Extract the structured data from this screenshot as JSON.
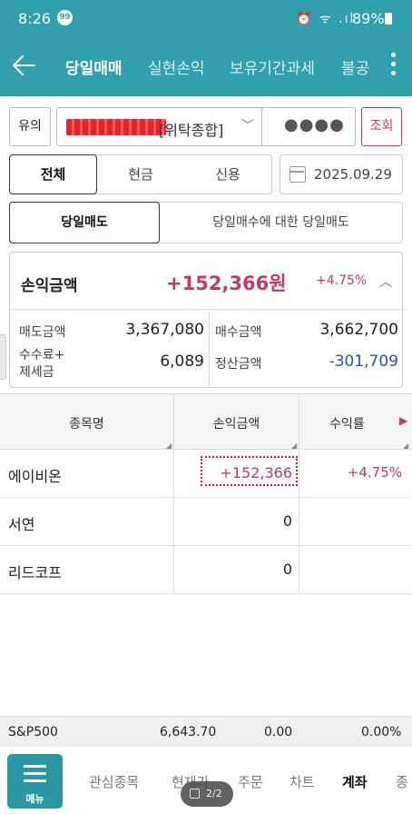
{
  "status_bar": {
    "time": "8:26",
    "badge": "99",
    "icons": "⏰ ᯤ .ıl",
    "battery": "89%"
  },
  "app_bar": {
    "tabs": [
      {
        "label": "당일매매",
        "active": true
      },
      {
        "label": "실현손익",
        "active": false
      },
      {
        "label": "보유기간과세",
        "active": false
      },
      {
        "label": "불공",
        "active": false
      }
    ]
  },
  "account": {
    "notice_label": "유의",
    "type": "[위탁종합]",
    "password_mask": "●●●●",
    "query_label": "조회"
  },
  "filter": {
    "tabs": [
      {
        "label": "전체",
        "active": true
      },
      {
        "label": "현금",
        "active": false
      },
      {
        "label": "신용",
        "active": false
      }
    ],
    "date": "2025.09.29"
  },
  "sell_type": {
    "tabs": [
      {
        "label": "당일매도",
        "active": true
      },
      {
        "label": "당일매수에 대한 당일매도",
        "active": false
      }
    ]
  },
  "summary": {
    "pl_label": "손익금액",
    "pl_value": "+152,366원",
    "pl_pct": "+4.75%",
    "sell_label": "매도금액",
    "sell_value": "3,367,080",
    "buy_label": "매수금액",
    "buy_value": "3,662,700",
    "fee_label_1": "수수료+",
    "fee_label_2": "제세금",
    "fee_value": "6,089",
    "settle_label": "정산금액",
    "settle_value": "-301,709"
  },
  "table": {
    "headers": [
      "종목명",
      "손익금액",
      "수익률"
    ],
    "rows": [
      {
        "name": "에이비온",
        "amount": "+152,366",
        "pct": "+4.75%"
      },
      {
        "name": "서연",
        "amount": "0",
        "pct": ""
      },
      {
        "name": "리드코프",
        "amount": "0",
        "pct": ""
      }
    ]
  },
  "ticker": {
    "name": "S&P500",
    "value": "6,643.70",
    "change": "0.00",
    "pct": "0.00%"
  },
  "bottom_nav": {
    "menu_label": "메뉴",
    "items": [
      {
        "label": "관심종목",
        "active": false
      },
      {
        "label": "현재가",
        "active": false
      },
      {
        "label": "주문",
        "active": false
      },
      {
        "label": "차트",
        "active": false
      },
      {
        "label": "계좌",
        "active": true
      },
      {
        "label": "종",
        "active": false
      }
    ],
    "pager": "2/2"
  },
  "colors": {
    "brand": "#2fa0ac",
    "positive": "#c33a6a",
    "negative": "#2a50b0",
    "active_border": "#2a3760"
  }
}
